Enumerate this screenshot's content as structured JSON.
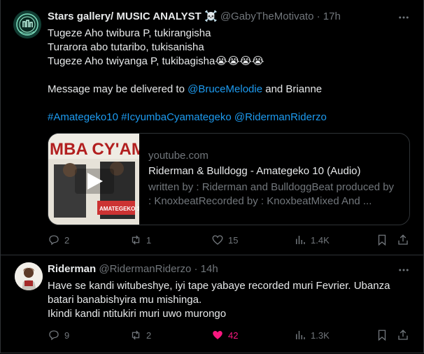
{
  "tweets": [
    {
      "display_name": "Stars gallery/ MUSIC ANALYST ☠️",
      "handle": "@GabyTheMotivato",
      "dot": "·",
      "time": "17h",
      "lines": [
        "Tugeze Aho twibura P, tukirangisha",
        "Turarora abo tutaribo, tukisanisha",
        "Tugeze Aho twiyanga P, tukibagisha😭😭😭😭"
      ],
      "message_prefix": "Message may be delivered to ",
      "message_mention": "@BruceMelodie",
      "message_suffix": " and Brianne",
      "hashtags": [
        "#Amategeko10",
        "#IcyumbaCyamategeko",
        "@RidermanRiderzo"
      ],
      "card": {
        "thumb_text": "MBA CY'AMATE",
        "thumb_sub": "AMATEGEKO 10",
        "domain": "youtube.com",
        "title": "Riderman & Bulldogg - Amategeko 10 (Audio)",
        "desc_1": "written by : Riderman and BulldoggBeat produced by",
        "desc_2": ": KnoxbeatRecorded by : KnoxbeatMixed And ..."
      },
      "counts": {
        "reply": "2",
        "retweet": "1",
        "like": "15",
        "views": "1.4K"
      }
    },
    {
      "display_name": "Riderman",
      "handle": "@RidermanRiderzo",
      "dot": "·",
      "time": "14h",
      "lines": [
        "Have se kandi witubeshye, iyi tape yabaye recorded muri Fevrier. Ubanza",
        "batari banabishyira mu mishinga.",
        "Ikindi kandi ntitukiri muri uwo murongo"
      ],
      "counts": {
        "reply": "9",
        "retweet": "2",
        "like": "42",
        "views": "1.3K"
      }
    }
  ],
  "colors": {
    "background": "#000000",
    "text": "#e7e9ea",
    "muted": "#71767b",
    "link": "#1d9bf0",
    "liked": "#f91880",
    "border": "#2f3336"
  }
}
